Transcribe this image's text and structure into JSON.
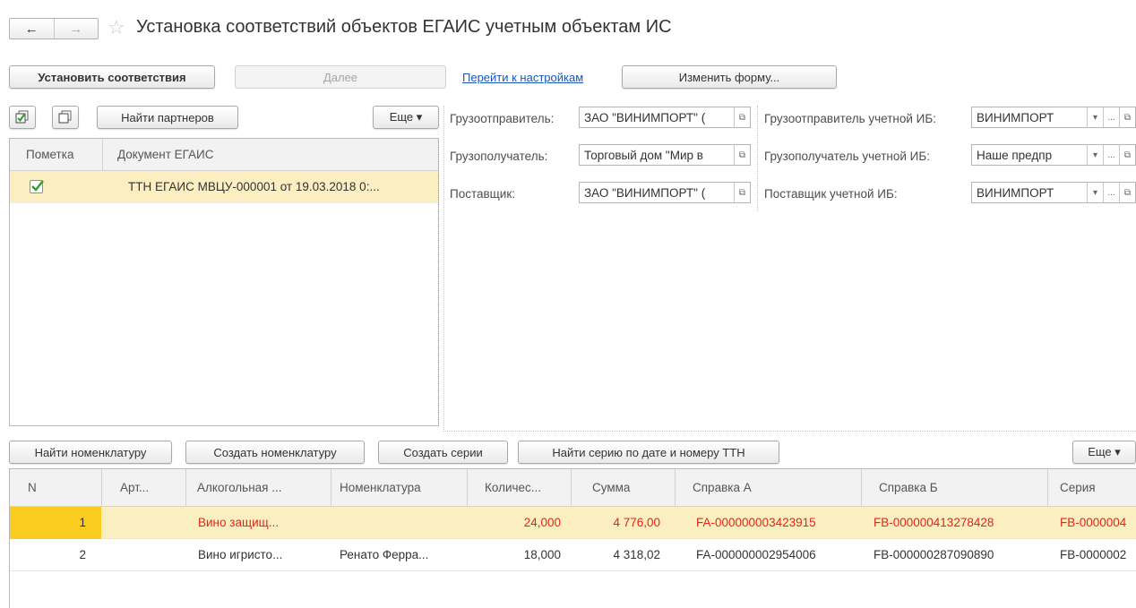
{
  "header": {
    "title": "Установка соответствий объектов ЕГАИС учетным объектам ИС",
    "back_glyph": "←",
    "forward_glyph": "→",
    "star_glyph": "☆"
  },
  "toolbar": {
    "set_matches": "Установить соответствия",
    "next": "Далее",
    "go_settings": "Перейти к настройкам",
    "change_form": "Изменить форму..."
  },
  "left_toolbar": {
    "find_partners": "Найти партнеров",
    "more": "Еще ▾"
  },
  "left_grid": {
    "columns": [
      "Пометка",
      "Документ ЕГАИС"
    ],
    "rows": [
      {
        "checked": true,
        "document": "ТТН ЕГАИС МВЦУ-000001 от 19.03.2018 0:..."
      }
    ]
  },
  "fields": {
    "shipper_label": "Грузоотправитель:",
    "shipper_value": "ЗАО \"ВИНИМПОРТ\" (",
    "consignee_label": "Грузополучатель:",
    "consignee_value": "Торговый дом \"Мир в",
    "supplier_label": "Поставщик:",
    "supplier_value": "ЗАО \"ВИНИМПОРТ\" (",
    "shipper_ib_label": "Грузоотправитель учетной ИБ:",
    "shipper_ib_value": "ВИНИМПОРТ",
    "consignee_ib_label": "Грузополучатель учетной ИБ:",
    "consignee_ib_value": "Наше предпр",
    "supplier_ib_label": "Поставщик учетной ИБ:",
    "supplier_ib_value": "ВИНИМПОРТ",
    "open_glyph": "⧉",
    "dropdown_glyph": "▾",
    "select_glyph": "..."
  },
  "bottom_toolbar": {
    "find_nomenclature": "Найти номенклатуру",
    "create_nomenclature": "Создать номенклатуру",
    "create_series": "Создать серии",
    "find_series": "Найти серию по дате и номеру ТТН",
    "more": "Еще ▾"
  },
  "bottom_grid": {
    "columns": [
      "N",
      "Арт...",
      "Алкогольная ...",
      "Номенклатура",
      "Количес...",
      "Сумма",
      "Справка А",
      "Справка Б",
      "Серия"
    ],
    "rows": [
      {
        "n": "1",
        "art": "",
        "alco": "Вино защищ...",
        "nom": "",
        "qty": "24,000",
        "sum": "4 776,00",
        "ref_a": "FA-000000003423915",
        "ref_b": "FB-000000413278428",
        "series": "FB-0000004"
      },
      {
        "n": "2",
        "art": "",
        "alco": "Вино игристо...",
        "nom": "Ренато Ферра...",
        "qty": "18,000",
        "sum": "4 318,02",
        "ref_a": "FA-000000002954006",
        "ref_b": "FB-000000287090890",
        "series": "FB-0000002"
      }
    ]
  },
  "colors": {
    "selected_row": "#fbeec1",
    "selected_cell": "#f9cc1f",
    "error_text": "#e1251b",
    "link": "#1a57b6",
    "check": "#2aa02a"
  }
}
